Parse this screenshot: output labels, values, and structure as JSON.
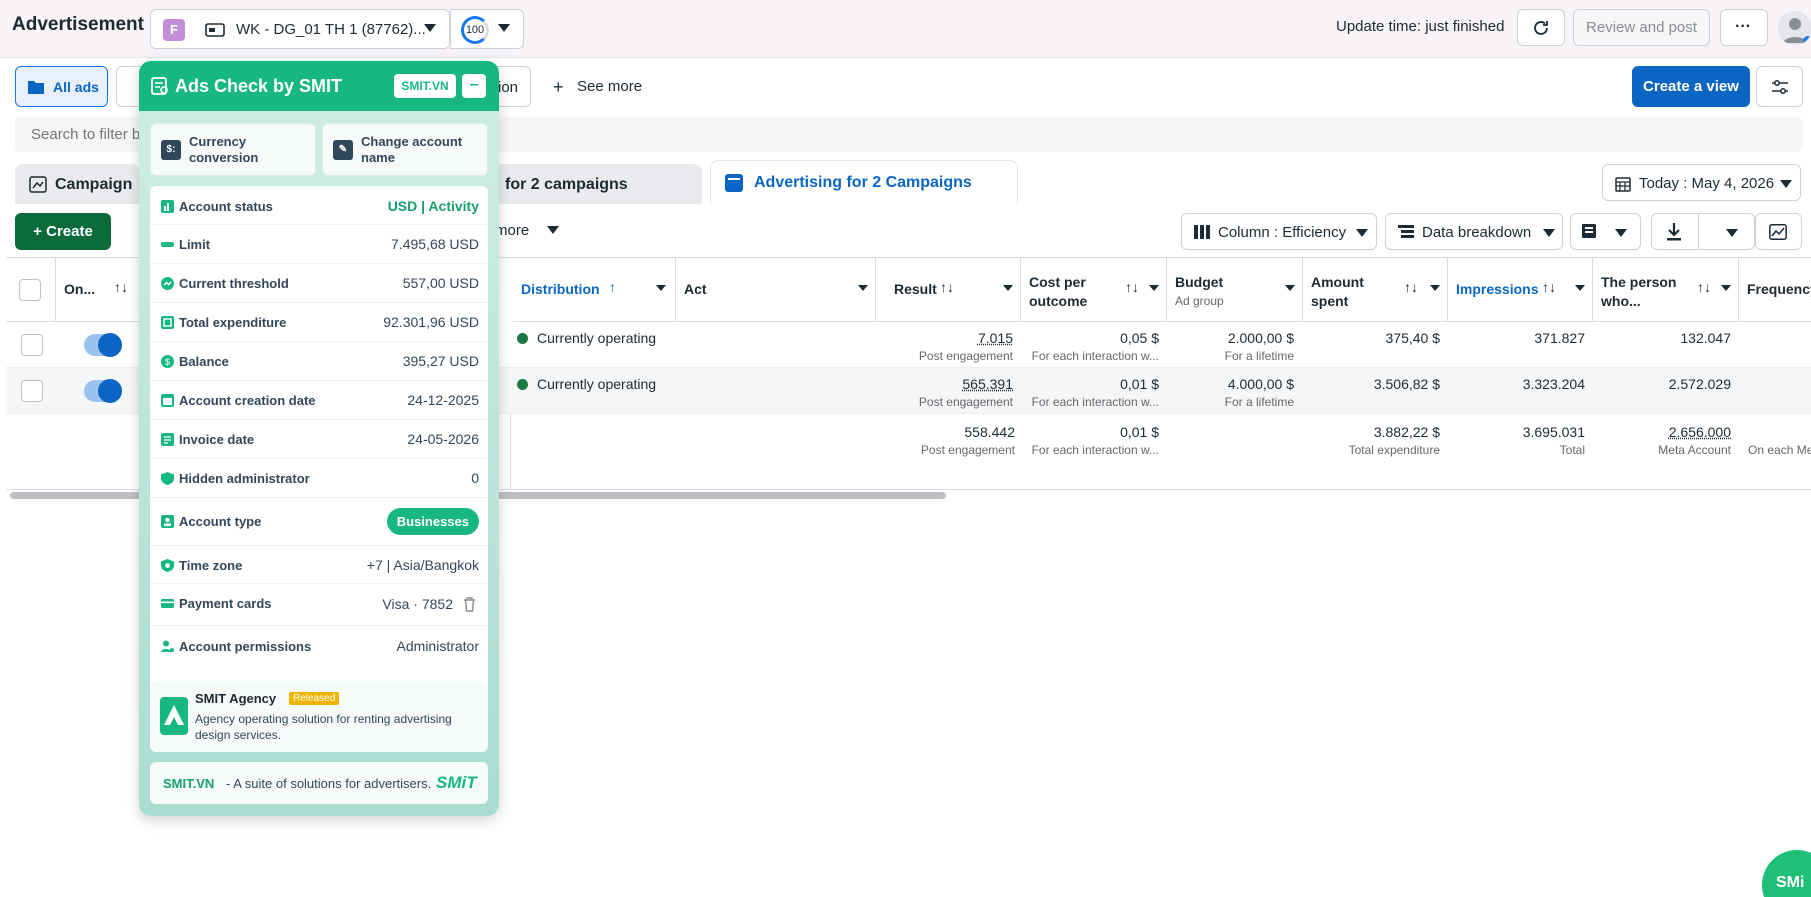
{
  "header": {
    "title": "Advertisement",
    "account_badge": "F",
    "account_name": "WK - DG_01 TH 1 (87762)...",
    "score": "100",
    "update_time": "Update time: just finished",
    "review_label": "Review and post",
    "more_label": "···"
  },
  "views": {
    "all_ads": "All ads",
    "campaigns_tail": "tion",
    "see_more": "See more",
    "create_view": "Create a view"
  },
  "search": {
    "placeholder": "Search to filter b"
  },
  "level_tabs": {
    "campaign": "Campaign",
    "adsets": "for 2 campaigns",
    "ads": "Advertising for 2 Campaigns"
  },
  "date_range": "Today : May 4, 2026",
  "toolbar": {
    "create": "Create",
    "more": "more",
    "columns": "Column : Efficiency",
    "breakdown": "Data breakdown"
  },
  "table": {
    "columns": {
      "onoff": "On...",
      "distribution": "Distribution",
      "act": "Act",
      "result": "Result",
      "cost": "Cost per outcome",
      "budget": "Budget",
      "budget_sub": "Ad group",
      "amount": "Amount spent",
      "impressions": "Impressions",
      "reach": "The person who...",
      "frequency": "Frequency"
    },
    "rows": [
      {
        "delivery": "Currently operating",
        "result": "7.015",
        "result_sub": "Post engagement",
        "cost": "0,05 $",
        "cost_sub": "For each interaction w...",
        "budget": "2.000,00 $",
        "budget_sub": "For a lifetime",
        "amount": "375,40 $",
        "impressions": "371.827",
        "reach": "132.047"
      },
      {
        "delivery": "Currently operating",
        "result": "565.391",
        "result_sub": "Post engagement",
        "cost": "0,01 $",
        "cost_sub": "For each interaction w...",
        "budget": "4.000,00 $",
        "budget_sub": "For a lifetime",
        "amount": "3.506,82 $",
        "impressions": "3.323.204",
        "reach": "2.572.029"
      }
    ],
    "totals": {
      "result": "558.442",
      "result_sub": "Post engagement",
      "cost": "0,01 $",
      "cost_sub": "For each interaction w...",
      "amount": "3.882,22 $",
      "amount_sub": "Total expenditure",
      "impressions": "3.695.031",
      "impressions_sub": "Total",
      "reach": "2.656.000",
      "reach_sub": "Meta Account",
      "frequency_sub": "On each Me"
    }
  },
  "panel": {
    "title": "Ads Check by SMIT",
    "brand": "SMIT.VN",
    "minimize": "–",
    "currency_conversion": "Currency conversion",
    "change_account_name": "Change account name",
    "rows": [
      {
        "label": "Account status",
        "value": "USD | Activity"
      },
      {
        "label": "Limit",
        "value": "7.495,68 USD"
      },
      {
        "label": "Current threshold",
        "value": "557,00 USD"
      },
      {
        "label": "Total expenditure",
        "value": "92.301,96 USD"
      },
      {
        "label": "Balance",
        "value": "395,27 USD"
      },
      {
        "label": "Account creation date",
        "value": "24-12-2025"
      },
      {
        "label": "Invoice date",
        "value": "24-05-2026"
      },
      {
        "label": "Hidden administrator",
        "value": "0"
      },
      {
        "label": "Account type",
        "value": "Businesses"
      },
      {
        "label": "Time zone",
        "value": "+7 | Asia/Bangkok"
      },
      {
        "label": "Payment cards",
        "value": "Visa · 7852"
      },
      {
        "label": "Account permissions",
        "value": "Administrator"
      }
    ],
    "agency": {
      "title": "SMIT Agency",
      "badge": "Released",
      "desc": "Agency operating solution for renting advertising design services."
    },
    "footer": {
      "brand": "SMIT.VN",
      "text": "- A suite of solutions for advertisers.",
      "logo": "SMiT"
    }
  },
  "fab_label": "SMi",
  "colors": {
    "accent_blue": "#0a66c2",
    "smit_green": "#17b880",
    "create_green": "#0b6b3a"
  }
}
